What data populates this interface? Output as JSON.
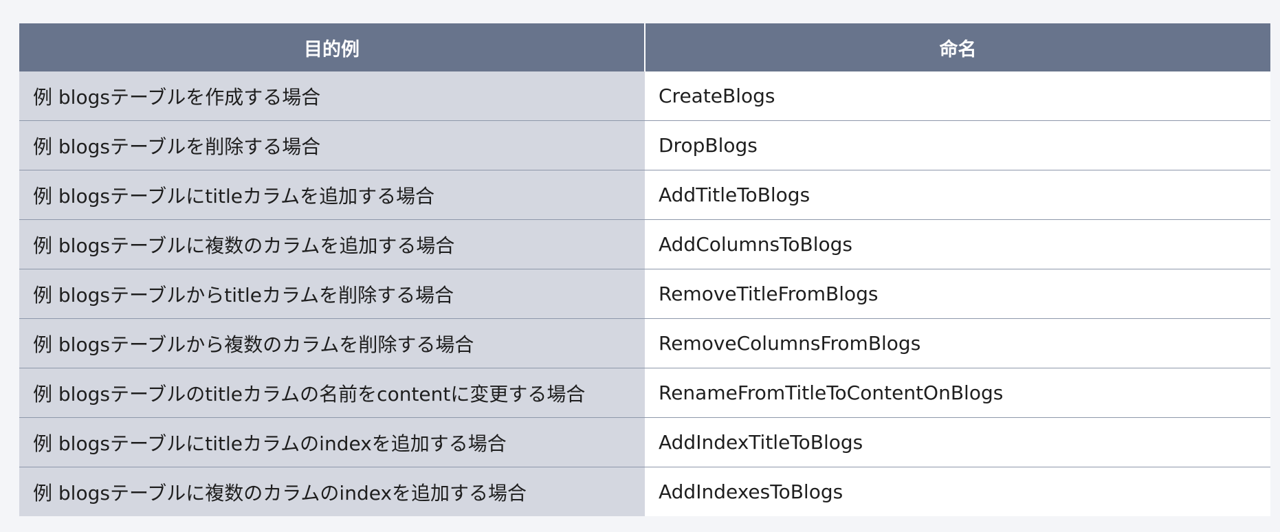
{
  "table": {
    "headers": {
      "purpose": "目的例",
      "name": "命名"
    },
    "rows": [
      {
        "purpose": "例 blogsテーブルを作成する場合",
        "name": "CreateBlogs"
      },
      {
        "purpose": "例 blogsテーブルを削除する場合",
        "name": "DropBlogs"
      },
      {
        "purpose": "例 blogsテーブルにtitleカラムを追加する場合",
        "name": "AddTitleToBlogs"
      },
      {
        "purpose": "例 blogsテーブルに複数のカラムを追加する場合",
        "name": "AddColumnsToBlogs"
      },
      {
        "purpose": "例 blogsテーブルからtitleカラムを削除する場合",
        "name": "RemoveTitleFromBlogs"
      },
      {
        "purpose": "例 blogsテーブルから複数のカラムを削除する場合",
        "name": "RemoveColumnsFromBlogs"
      },
      {
        "purpose": "例 blogsテーブルのtitleカラムの名前をcontentに変更する場合",
        "name": "RenameFromTitleToContentOnBlogs"
      },
      {
        "purpose": "例 blogsテーブルにtitleカラムのindexを追加する場合",
        "name": "AddIndexTitleToBlogs"
      },
      {
        "purpose": "例 blogsテーブルに複数のカラムのindexを追加する場合",
        "name": "AddIndexesToBlogs"
      }
    ],
    "colors": {
      "header_bg": "#68748c",
      "purpose_bg": "#d4d7e0",
      "name_bg": "#ffffff",
      "page_bg": "#f4f5f8"
    }
  }
}
